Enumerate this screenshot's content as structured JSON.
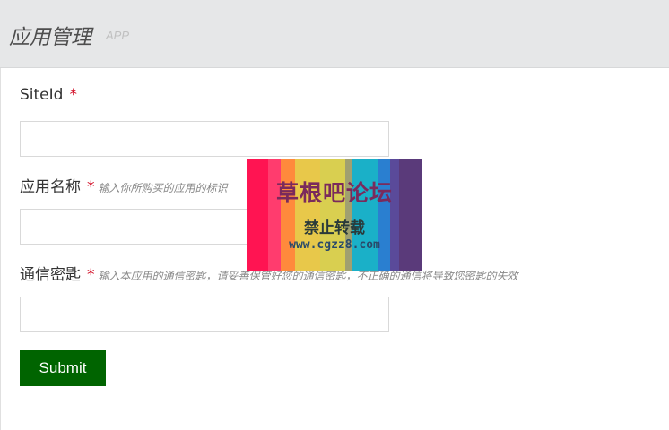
{
  "header": {
    "title": "应用管理",
    "subtitle": "APP"
  },
  "form": {
    "fields": [
      {
        "label": "SiteId",
        "required_mark": "*",
        "hint": "",
        "value": ""
      },
      {
        "label": "应用名称",
        "required_mark": "*",
        "hint": "输入你所购买的应用的标识",
        "value": ""
      },
      {
        "label": "通信密匙",
        "required_mark": "*",
        "hint": "输入本应用的通信密匙，请妥善保管好您的通信密匙，不正确的通信将导致您密匙的失效",
        "value": ""
      }
    ],
    "submit_label": "Submit"
  },
  "watermark": {
    "line1": "草根吧论坛",
    "line2": "禁止转载",
    "line3": "www.cgzz8.com",
    "stripe_colors": [
      "#ff1452",
      "#ff3c6e",
      "#ff8a3c",
      "#e8c84a",
      "#d9cf50",
      "#a0a070",
      "#1ab0c8",
      "#2a7fd0",
      "#5a4a9a",
      "#5a3a7a"
    ]
  },
  "colors": {
    "header_bg": "#e6e7e8",
    "required": "#d0021b",
    "submit_bg": "#006400"
  }
}
